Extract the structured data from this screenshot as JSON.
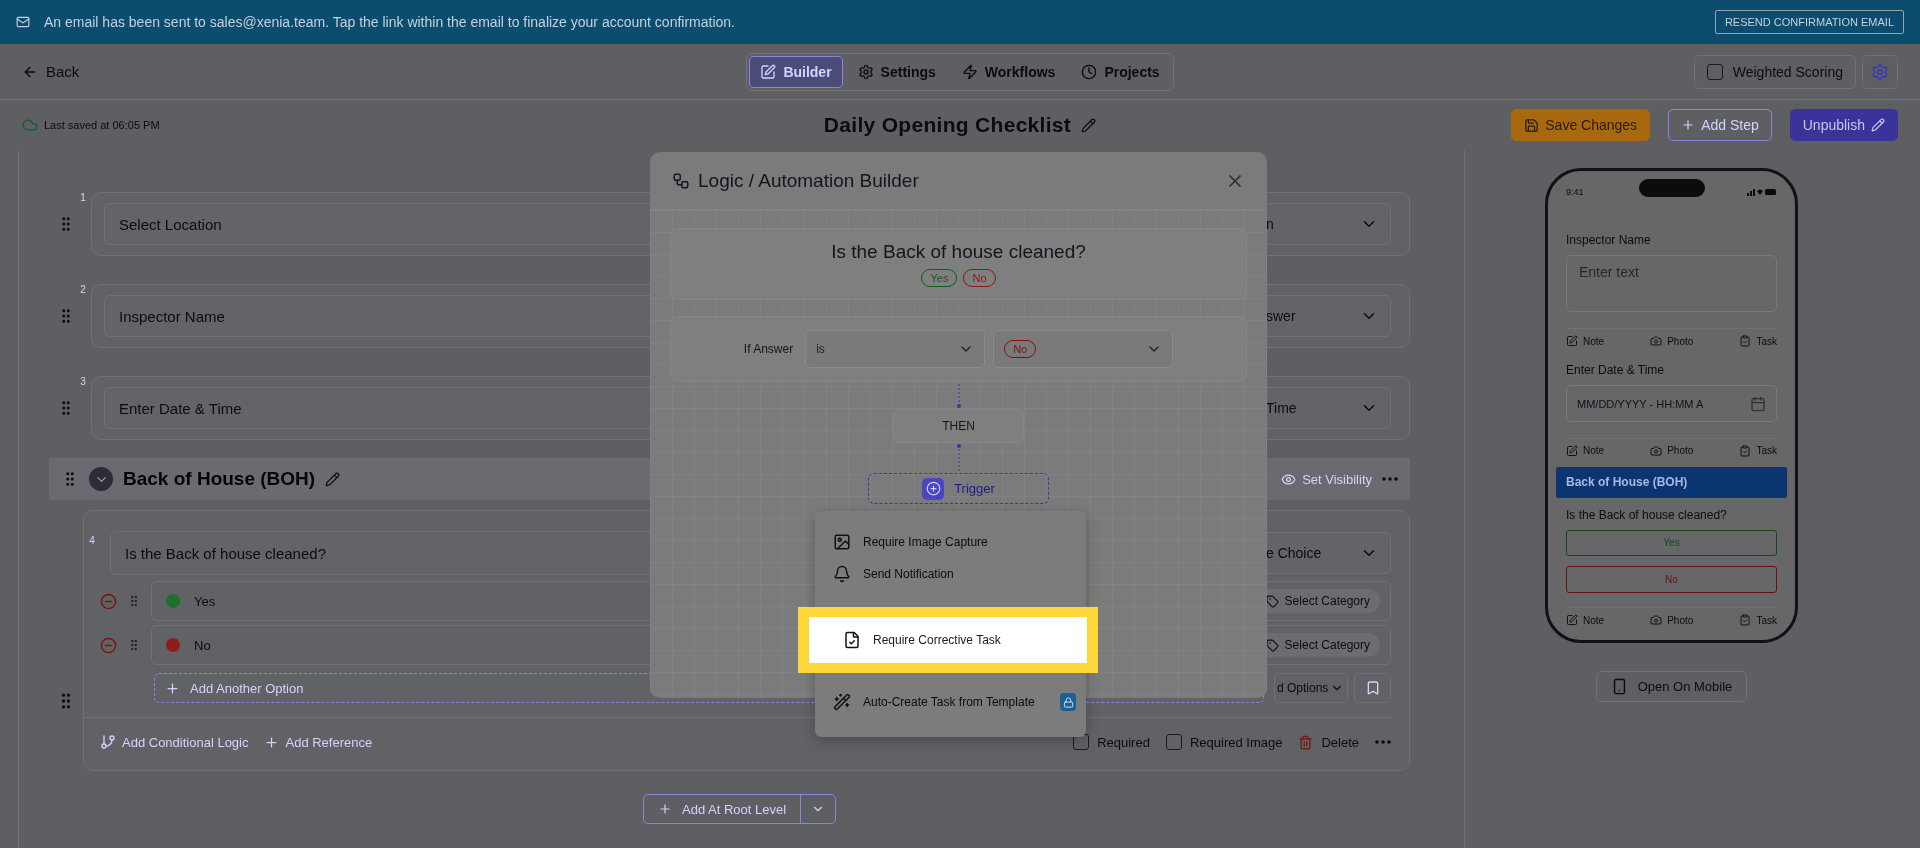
{
  "banner": {
    "message": "An email has been sent to sales@xenia.team. Tap the link within the email to finalize your account confirmation.",
    "button": "RESEND CONFIRMATION EMAIL"
  },
  "header": {
    "back": "Back",
    "tabs": [
      {
        "label": "Builder",
        "kind": "builder",
        "selected": true
      },
      {
        "label": "Settings",
        "kind": "settings",
        "selected": false
      },
      {
        "label": "Workflows",
        "kind": "workflows",
        "selected": false
      },
      {
        "label": "Projects",
        "kind": "projects",
        "selected": false
      }
    ],
    "weighted_scoring": {
      "label": "Weighted Scoring",
      "checked": false
    }
  },
  "subheader": {
    "last_saved": "Last saved at 06:05 PM",
    "title": "Daily Opening Checklist",
    "buttons": [
      {
        "label": "Save Changes",
        "kind": "save"
      },
      {
        "label": "Add Step",
        "kind": "add"
      },
      {
        "label": "Unpublish",
        "kind": "unpublish"
      }
    ]
  },
  "editor": {
    "questions": [
      {
        "number": "1",
        "title": "Select Location",
        "type": "n"
      },
      {
        "number": "2",
        "title": "Inspector Name",
        "type": "swer"
      },
      {
        "number": "3",
        "title": "Enter Date & Time",
        "type": "Time"
      }
    ],
    "section": {
      "title": "Back of House (BOH)",
      "expanded": true,
      "set_visibility": "Set Visibility",
      "question": {
        "number": "4",
        "title": "Is the Back of house cleaned?",
        "type": "e Choice",
        "options": [
          {
            "label": "Yes",
            "color": "#1f6e2c",
            "category": "Select Category"
          },
          {
            "label": "No",
            "color": "#8e1d1d",
            "category": "Select Category"
          }
        ],
        "add_option": "Add Another Option",
        "advanced": "d Options",
        "footer": {
          "conditional": "Add Conditional Logic",
          "reference": "Add Reference",
          "required": {
            "label": "Required",
            "checked": false
          },
          "required_image": {
            "label": "Required Image",
            "checked": false
          },
          "delete": "Delete"
        }
      }
    },
    "add_root": "Add At Root Level"
  },
  "modal": {
    "title": "Logic / Automation Builder",
    "question": "Is the Back of house cleaned?",
    "answers": [
      {
        "label": "Yes",
        "color": "#0f5a1c"
      },
      {
        "label": "No",
        "color": "#8a1a12"
      }
    ],
    "condition": {
      "label": "If Answer",
      "operator": "is",
      "value": "No"
    },
    "then": "THEN",
    "trigger": "Trigger",
    "menu": [
      {
        "label": "Require Image Capture",
        "kind": "image",
        "selected": false,
        "locked": false
      },
      {
        "label": "Send Notification",
        "kind": "bell",
        "selected": false,
        "locked": false
      },
      {
        "label": "Require Corrective Task",
        "kind": "task",
        "selected": true,
        "locked": false
      },
      {
        "label": "Auto-Create Task from Template",
        "kind": "wand",
        "selected": false,
        "locked": true
      }
    ]
  },
  "preview": {
    "time": "9:41",
    "fields": [
      {
        "label": "Inspector Name",
        "kind": "text",
        "placeholder": "Enter text",
        "actions": [
          "Note",
          "Photo",
          "Task"
        ]
      },
      {
        "label": "Enter Date & Time",
        "kind": "datetime",
        "placeholder": "MM/DD/YYYY - HH:MM A",
        "actions": [
          "Note",
          "Photo",
          "Task"
        ]
      }
    ],
    "section": "Back of House (BOH)",
    "question": {
      "label": "Is the Back of house cleaned?",
      "options": [
        {
          "label": "Yes",
          "color": "#0f4a18"
        },
        {
          "label": "No",
          "color": "#6a1010"
        }
      ],
      "actions": [
        "Note",
        "Photo",
        "Task"
      ]
    },
    "open_on_mobile": "Open On Mobile"
  }
}
